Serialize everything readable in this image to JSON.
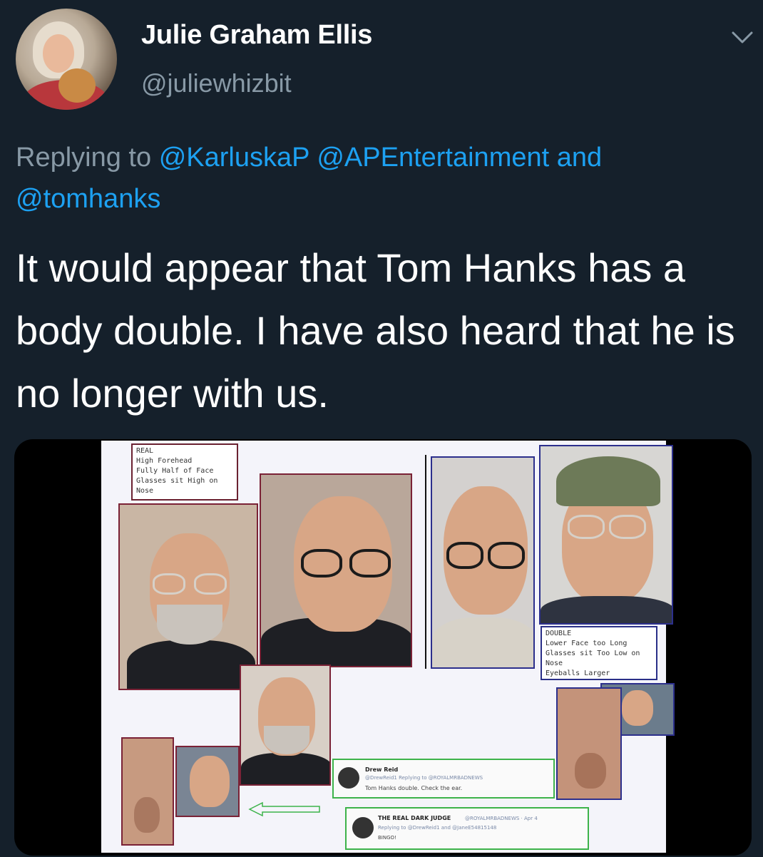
{
  "header": {
    "display_name": "Julie Graham Ellis",
    "handle": "@juliewhizbit",
    "menu_icon": "chevron-down-icon"
  },
  "reply": {
    "prefix": "Replying to",
    "mention_1": "@KarluskaP",
    "mention_2": "@APEntertainment",
    "conjunction": "and",
    "mention_3": "@tomhanks"
  },
  "tweet": {
    "text": "It would appear that Tom Hanks has a body double. I have also heard that he is no longer with us."
  },
  "media": {
    "real_caption": [
      "REAL",
      "High Forehead",
      "Fully Half of Face",
      "Glasses sit High on Nose"
    ],
    "double_caption": [
      "DOUBLE",
      "Lower Face too Long",
      "Glasses sit Too Low on Nose",
      "Eyeballs Larger"
    ],
    "reply_card_1": {
      "name": "Drew Reid",
      "meta": "@DrewReid1 Replying to @ROYALMRBADNEWS",
      "text": "Tom Hanks double. Check the ear."
    },
    "reply_card_2": {
      "name": "THE REAL DARK JUDGE",
      "meta": "@ROYALMRBADNEWS · Apr 4",
      "replying": "Replying to @DrewReid1 and @JaneE54815148",
      "text": "BINGO!"
    },
    "colors": {
      "real_border": "#7a2236",
      "double_border": "#2c2f8c",
      "reply_border": "#3db34a"
    }
  }
}
